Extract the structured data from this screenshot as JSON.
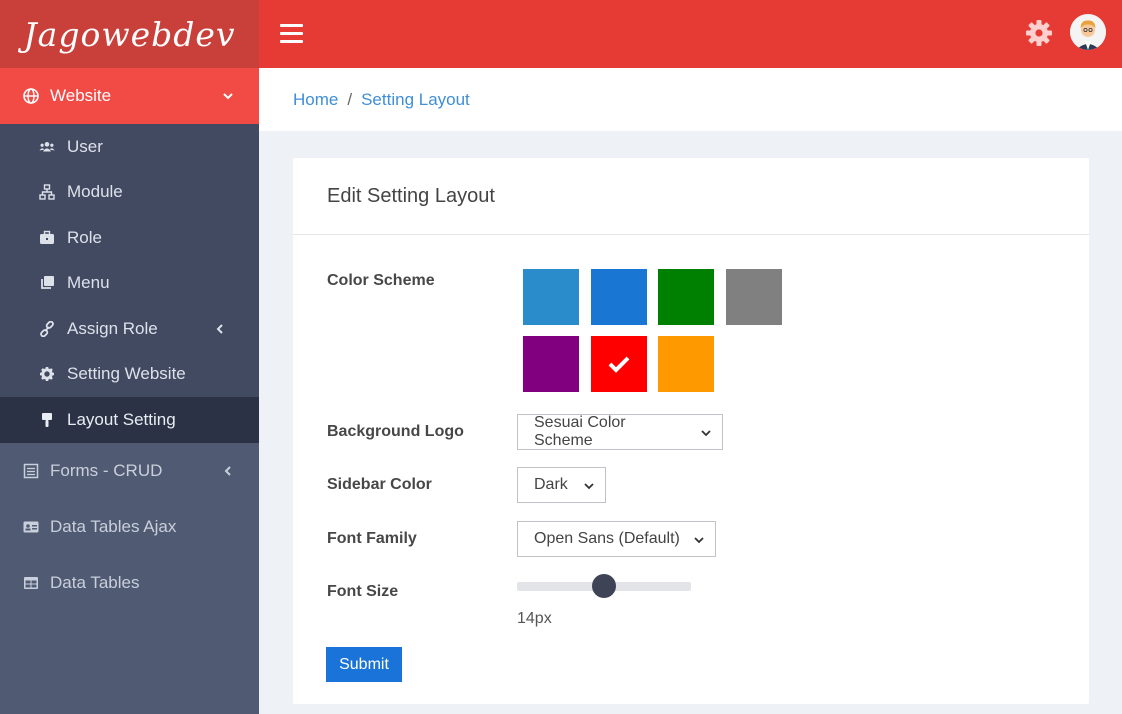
{
  "brand": {
    "name": "Jagowebdev"
  },
  "sidebar": {
    "top": {
      "label": "Website",
      "icon": "globe-icon"
    },
    "sub_items": [
      {
        "label": "User",
        "icon": "users-icon"
      },
      {
        "label": "Module",
        "icon": "sitemap-icon"
      },
      {
        "label": "Role",
        "icon": "briefcase-icon"
      },
      {
        "label": "Menu",
        "icon": "clone-icon"
      },
      {
        "label": "Assign Role",
        "icon": "link-icon"
      },
      {
        "label": "Setting Website",
        "icon": "gear-icon"
      },
      {
        "label": "Layout Setting",
        "icon": "brush-icon",
        "active": true
      }
    ],
    "items": [
      {
        "label": "Forms - CRUD",
        "icon": "form-icon"
      },
      {
        "label": "Data Tables Ajax",
        "icon": "id-card-icon"
      },
      {
        "label": "Data Tables",
        "icon": "table-icon"
      }
    ]
  },
  "breadcrumb": {
    "home": "Home",
    "separator": "/",
    "current": "Setting Layout"
  },
  "card": {
    "title": "Edit Setting Layout"
  },
  "form": {
    "color_scheme": {
      "label": "Color Scheme",
      "swatches": [
        "#2b8ccb",
        "#1976d2",
        "#008000",
        "#808080",
        "#800080",
        "#ff0000",
        "#ff9900"
      ],
      "selected_index": 5
    },
    "background_logo": {
      "label": "Background Logo",
      "value": "Sesuai Color Scheme"
    },
    "sidebar_color": {
      "label": "Sidebar Color",
      "value": "Dark"
    },
    "font_family": {
      "label": "Font Family",
      "value": "Open Sans (Default)"
    },
    "font_size": {
      "label": "Font Size",
      "value": "14px",
      "level": 0.5
    },
    "submit_label": "Submit"
  }
}
